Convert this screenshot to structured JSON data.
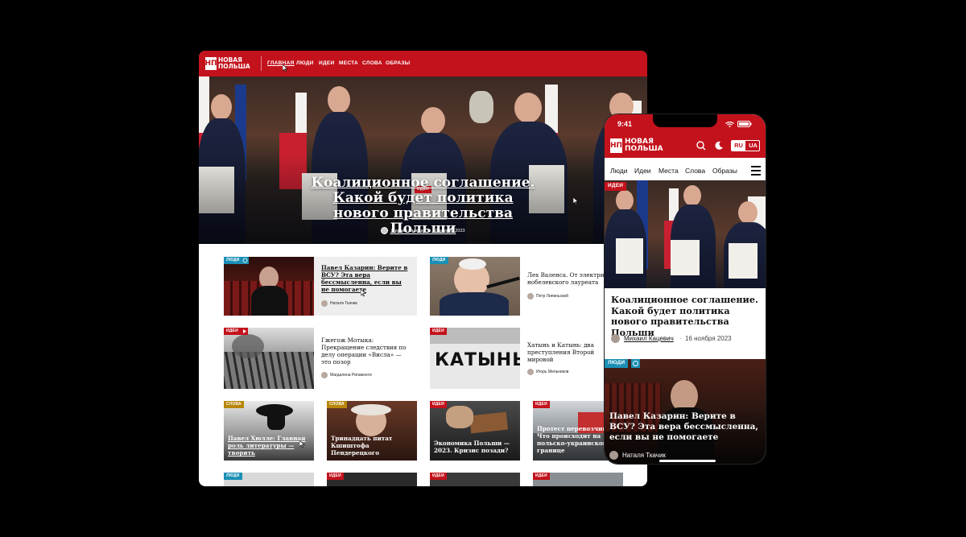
{
  "desktop": {
    "logo_mark": "НП",
    "logo_line1": "НОВАЯ",
    "logo_line2": "ПОЛЬША",
    "nav": [
      "ГЛАВНАЯ",
      "ЛЮДИ",
      "ИДЕИ",
      "МЕСТА",
      "СЛОВА",
      "ОБРАЗЫ"
    ],
    "hero": {
      "tag": "ИДЕИ",
      "title": "Коалиционное соглашение. Какой будет политика нового правительства Польши",
      "author": "Михаил Кацевич",
      "date": "16 ноября 2023"
    },
    "cards": [
      {
        "tag": "ЛЮДИ",
        "title": "Павел Казарин: Верите в ВСУ? Эта вера бессмысленна, если вы не помогаете",
        "author": "Наталя Ткачик"
      },
      {
        "tag": "ЛЮДИ",
        "title": "Лех Валенса. От электрика до нобелевского лауреата",
        "author": "Петр Липиньский"
      },
      {
        "tag": "ИДЕИ",
        "title": "Гжегож Мотыка: Прекращение следствия по делу операции «Висла» — это позор",
        "author": "Магдалена Ригамонти"
      },
      {
        "tag": "ИДЕИ",
        "title": "Хатынь и Катынь: два преступления Второй мировой",
        "author": "Игорь Мельников",
        "image_text": "КАТЫНЬ"
      },
      {
        "tag": "СЛОВА",
        "title": "Павел Хюлле: Главная роль литературы — творить"
      },
      {
        "tag": "СЛОВА",
        "title": "Тринадцать питат Кшиштофа Пендерецкого"
      },
      {
        "tag": "ИДЕИ",
        "title": "Экономика Польши — 2023. Кризис позади?"
      },
      {
        "tag": "ИДЕИ",
        "title": "Протест перевозчиков. Что происходит на польско-украинской границе"
      }
    ],
    "bottom_tags": [
      "ЛЮДИ",
      "ИДЕИ",
      "ИДЕИ",
      "ИДЕИ"
    ]
  },
  "phone": {
    "time": "9:41",
    "logo_line1": "НОВАЯ",
    "logo_line2": "ПОЛЬША",
    "lang": [
      "RU",
      "UA"
    ],
    "nav": [
      "Люди",
      "Идеи",
      "Места",
      "Слова",
      "Образы"
    ],
    "hero": {
      "tag": "ИДЕИ",
      "title": "Коалиционное соглашение. Какой будет политика нового правительства Польши",
      "author": "Михаил Кацевич",
      "date": "16 ноября 2023"
    },
    "second": {
      "tag": "ЛЮДИ",
      "title": "Павел Казарин: Верите в ВСУ? Эта вера бессмысленна, если вы не помогаете",
      "author": "Наталя Ткачик"
    }
  },
  "colors": {
    "brand_red": "#c3121c",
    "tag_blue": "#1a8fb5"
  }
}
